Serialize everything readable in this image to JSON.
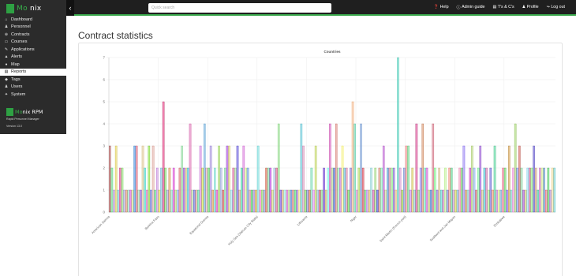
{
  "sidebar": {
    "logo_text_a": "Mo",
    "logo_text_b": "nix",
    "items": [
      {
        "icon": "dashboard-icon",
        "glyph": "⌂",
        "label": "Dashboard",
        "active": false
      },
      {
        "icon": "personnel-icon",
        "glyph": "♟",
        "label": "Personnel",
        "active": false
      },
      {
        "icon": "contracts-icon",
        "glyph": "⊕",
        "label": "Contracts",
        "active": false
      },
      {
        "icon": "courses-icon",
        "glyph": "▭",
        "label": "Courses",
        "active": false
      },
      {
        "icon": "applications-icon",
        "glyph": "✎",
        "label": "Applications",
        "active": false
      },
      {
        "icon": "alerts-icon",
        "glyph": "▲",
        "label": "Alerts",
        "active": false
      },
      {
        "icon": "map-icon",
        "glyph": "●",
        "label": "Map",
        "active": false
      },
      {
        "icon": "reports-icon",
        "glyph": "▤",
        "label": "Reports",
        "active": true
      },
      {
        "icon": "tags-icon",
        "glyph": "◆",
        "label": "Tags",
        "active": false
      },
      {
        "icon": "users-icon",
        "glyph": "♟",
        "label": "Users",
        "active": false
      },
      {
        "icon": "system-icon",
        "glyph": "✦",
        "label": "System",
        "active": false
      }
    ],
    "brand_a": "Mo",
    "brand_b": "nix RPM",
    "brand_sub": "Rapid Personnel Manager",
    "version": "Version 13.0"
  },
  "topbar": {
    "collapse_glyph": "‹",
    "search_placeholder": "Quick search",
    "links": [
      {
        "icon": "help-icon",
        "glyph": "❓",
        "label": "Help"
      },
      {
        "icon": "info-icon",
        "glyph": "ⓘ",
        "label": "Admin guide"
      },
      {
        "icon": "document-icon",
        "glyph": "▤",
        "label": "T's & C's"
      },
      {
        "icon": "user-icon",
        "glyph": "♟",
        "label": "Profile"
      },
      {
        "icon": "logout-icon",
        "glyph": "↪",
        "label": "Log out"
      }
    ]
  },
  "page": {
    "title": "Contract statistics"
  },
  "chart_data": {
    "type": "bar",
    "title": "Countries",
    "ylim": [
      0,
      7
    ],
    "yticks": [
      0,
      1,
      2,
      3,
      4,
      5,
      6,
      7
    ],
    "grid": true,
    "legend": "none",
    "tick_labels": [
      {
        "label": "American Samoa",
        "index": 0
      },
      {
        "label": "Burkina Faso",
        "index": 24
      },
      {
        "label": "Equatorial Guinea",
        "index": 48
      },
      {
        "label": "Holy See (Vatican City State)",
        "index": 72
      },
      {
        "label": "Lithuania",
        "index": 96
      },
      {
        "label": "Niger",
        "index": 120
      },
      {
        "label": "Saint Martin (French part)",
        "index": 144
      },
      {
        "label": "Svalbard and Jan Mayen",
        "index": 168
      },
      {
        "label": "Zimbabwe",
        "index": 192
      }
    ],
    "values": [
      3,
      2,
      1,
      3,
      1,
      2,
      2,
      1,
      1,
      1,
      1,
      1,
      3,
      3,
      1,
      1,
      3,
      2,
      1,
      3,
      1,
      3,
      1,
      2,
      1,
      2,
      5,
      2,
      1,
      2,
      1,
      2,
      1,
      1,
      2,
      3,
      2,
      2,
      2,
      4,
      1,
      1,
      1,
      1,
      3,
      2,
      4,
      2,
      2,
      3,
      1,
      2,
      1,
      3,
      2,
      1,
      2,
      3,
      3,
      1,
      2,
      2,
      3,
      1,
      2,
      3,
      2,
      2,
      1,
      1,
      1,
      1,
      3,
      1,
      1,
      1,
      2,
      2,
      2,
      1,
      2,
      2,
      4,
      1,
      1,
      1,
      1,
      1,
      1,
      1,
      1,
      1,
      1,
      4,
      3,
      1,
      1,
      1,
      2,
      1,
      3,
      1,
      1,
      1,
      2,
      1,
      2,
      4,
      2,
      2,
      4,
      2,
      2,
      3,
      2,
      2,
      1,
      2,
      5,
      4,
      1,
      2,
      4,
      2,
      1,
      1,
      1,
      2,
      1,
      2,
      1,
      2,
      2,
      3,
      1,
      2,
      2,
      2,
      2,
      1,
      7,
      2,
      1,
      2,
      3,
      3,
      1,
      2,
      1,
      4,
      1,
      2,
      4,
      2,
      2,
      1,
      1,
      4,
      2,
      1,
      2,
      1,
      1,
      2,
      1,
      2,
      2,
      1,
      1,
      1,
      2,
      2,
      3,
      1,
      1,
      2,
      3,
      2,
      1,
      2,
      3,
      1,
      2,
      2,
      1,
      2,
      1,
      3,
      1,
      1,
      1,
      2,
      2,
      1,
      3,
      1,
      2,
      4,
      2,
      3,
      2,
      1,
      1,
      2,
      2,
      2,
      3,
      2,
      1,
      2,
      2,
      2,
      1,
      2,
      1,
      2,
      2
    ]
  }
}
